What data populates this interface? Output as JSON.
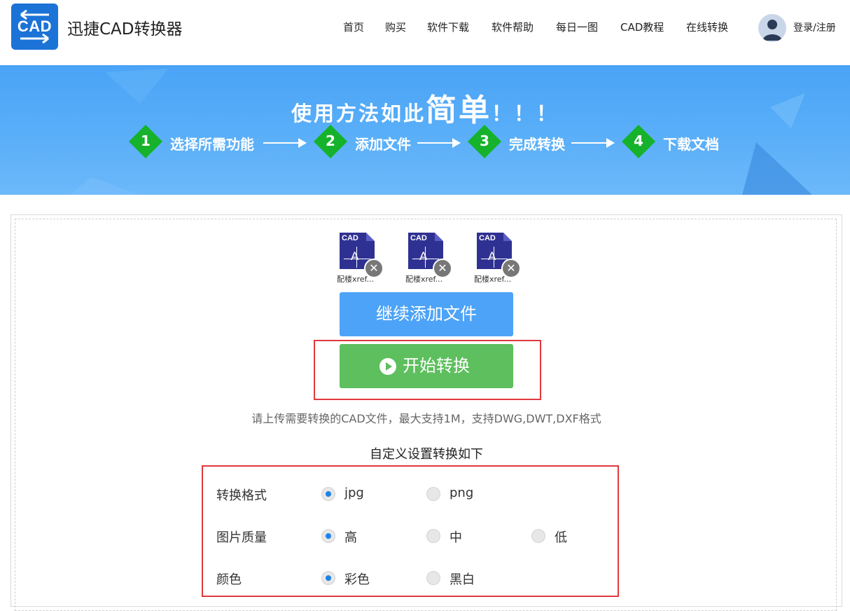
{
  "header": {
    "logo_text": "CAD",
    "brand": "迅捷CAD转换器",
    "nav": [
      "首页",
      "购买",
      "软件下载",
      "软件帮助",
      "每日一图",
      "CAD教程",
      "在线转换"
    ],
    "login": "登录/注册"
  },
  "banner": {
    "title_prefix": "使用方法如此",
    "title_emphasis": "简单",
    "title_suffix": "！！！",
    "steps": [
      {
        "num": "1",
        "text": "选择所需功能"
      },
      {
        "num": "2",
        "text": "添加文件"
      },
      {
        "num": "3",
        "text": "完成转换"
      },
      {
        "num": "4",
        "text": "下载文档"
      }
    ]
  },
  "files": [
    {
      "icon_text": "CAD",
      "glyph": "A",
      "name": "配楼xref..."
    },
    {
      "icon_text": "CAD",
      "glyph": "A",
      "name": "配楼xref..."
    },
    {
      "icon_text": "CAD",
      "glyph": "A",
      "name": "配楼xref..."
    }
  ],
  "buttons": {
    "add_more": "继续添加文件",
    "start": "开始转换"
  },
  "hint": "请上传需要转换的CAD文件，最大支持1M，支持DWG,DWT,DXF格式",
  "settings": {
    "title": "自定义设置转换如下",
    "rows": [
      {
        "label": "转换格式",
        "options": [
          {
            "label": "jpg",
            "selected": true
          },
          {
            "label": "png",
            "selected": false
          }
        ]
      },
      {
        "label": "图片质量",
        "options": [
          {
            "label": "高",
            "selected": true
          },
          {
            "label": "中",
            "selected": false
          },
          {
            "label": "低",
            "selected": false
          }
        ]
      },
      {
        "label": "颜色",
        "options": [
          {
            "label": "彩色",
            "selected": true
          },
          {
            "label": "黑白",
            "selected": false
          }
        ]
      }
    ]
  },
  "colors": {
    "brand_blue": "#1b73d7",
    "banner_blue": "#4aa3f6",
    "step_green": "#16b22c",
    "add_button": "#4da3f7",
    "start_button": "#5dbf5d",
    "highlight_red": "#e0393e",
    "radio_selected": "#1f82e8"
  }
}
